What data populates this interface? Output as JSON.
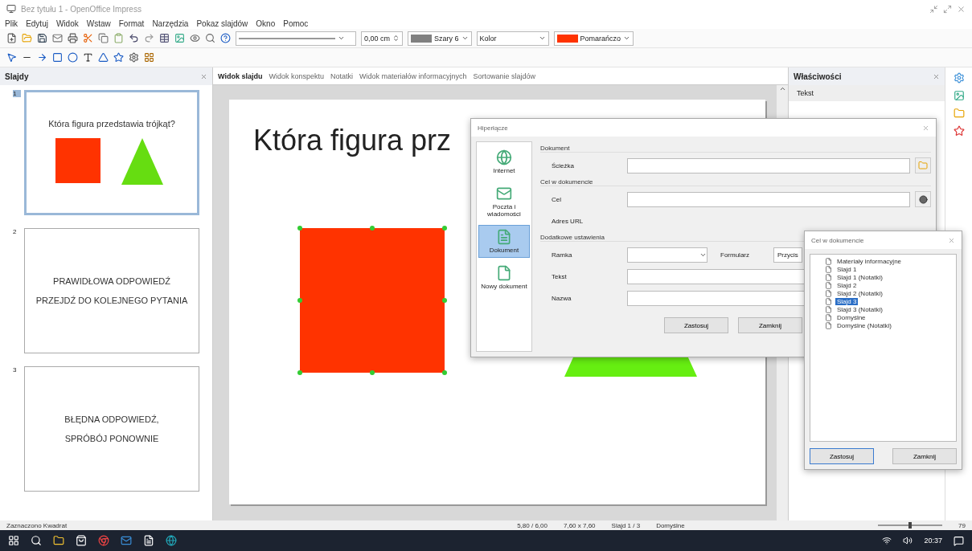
{
  "window": {
    "title": "Bez tytułu 1 - OpenOffice Impress"
  },
  "menu": [
    "Plik",
    "Edytuj",
    "Widok",
    "Wstaw",
    "Format",
    "Narzędzia",
    "Pokaz slajdów",
    "Okno",
    "Pomoc"
  ],
  "toolbar_fields": [
    {
      "kind": "line"
    },
    {
      "kind": "spin",
      "value": "0,00 cm"
    },
    {
      "kind": "color",
      "value": "Szary 6",
      "color": "#808080"
    },
    {
      "kind": "combo",
      "value": "Kolor"
    },
    {
      "kind": "color",
      "value": "Pomarańczo",
      "color": "#ff3300"
    }
  ],
  "slides_panel": {
    "title": "Slajdy",
    "slides": [
      {
        "number": "1",
        "selected": true,
        "kind": "question",
        "lines": [
          "Która figura przedstawia trójkąt?"
        ]
      },
      {
        "number": "2",
        "selected": false,
        "kind": "text",
        "lines": [
          "PRAWIDŁOWA ODPOWIEDŹ",
          "PRZEJDŹ DO KOLEJNEGO PYTANIA"
        ]
      },
      {
        "number": "3",
        "selected": false,
        "kind": "text",
        "lines": [
          "BŁĘDNA ODPOWIEDŹ,",
          "SPRÓBÓJ PONOWNIE"
        ]
      }
    ]
  },
  "view_tabs": [
    {
      "label": "Widok slajdu",
      "selected": true
    },
    {
      "label": "Widok konspektu",
      "selected": false
    },
    {
      "label": "Notatki",
      "selected": false
    },
    {
      "label": "Widok materiałów informacyjnych",
      "selected": false
    },
    {
      "label": "Sortowanie slajdów",
      "selected": false
    }
  ],
  "slide": {
    "title": "Która figura prz"
  },
  "properties": {
    "title": "Właściwości",
    "section": "Tekst"
  },
  "hyperlink_dialog": {
    "title": "Hiperłącze",
    "categories": [
      {
        "label": "Internet",
        "selected": false
      },
      {
        "label": "Poczta i wiadomości",
        "selected": false
      },
      {
        "label": "Dokument",
        "selected": true
      },
      {
        "label": "Nowy dokument",
        "selected": false
      }
    ],
    "document_group": {
      "title": "Dokument",
      "path_label": "Ścieżka"
    },
    "target_group": {
      "title": "Cel w dokumencie",
      "target_label": "Cel",
      "url_label": "Adres URL"
    },
    "extra_group": {
      "title": "Dodatkowe ustawienia",
      "frame_label": "Ramka",
      "form_label": "Formularz",
      "form_value": "Przycis",
      "text_label": "Tekst",
      "name_label": "Nazwa"
    },
    "buttons": [
      "Zastosuj",
      "Zamknij"
    ]
  },
  "target_dialog": {
    "title": "Cel w dokumencie",
    "items": [
      {
        "label": "Materiały informacyjne",
        "selected": false
      },
      {
        "label": "Slajd 1",
        "selected": false
      },
      {
        "label": "Slajd 1 (Notatki)",
        "selected": false
      },
      {
        "label": "Slajd 2",
        "selected": false
      },
      {
        "label": "Slajd 2 (Notatki)",
        "selected": false
      },
      {
        "label": "Slajd 3",
        "selected": true
      },
      {
        "label": "Slajd 3 (Notatki)",
        "selected": false
      },
      {
        "label": "Domyślne",
        "selected": false
      },
      {
        "label": "Domyślne (Notatki)",
        "selected": false
      }
    ],
    "buttons": [
      "Zastosuj",
      "Zamknij"
    ]
  },
  "status_bar": {
    "status": "Zaznaczono Kwadrat",
    "position": "5,80 / 6,00",
    "size": "7,60 x 7,60",
    "slide": "Slajd 1 / 3",
    "layout": "Domyślne",
    "zoom_slider": {
      "level": 0.5
    },
    "zoom": "79"
  },
  "taskbar": {
    "time": "20:37"
  }
}
